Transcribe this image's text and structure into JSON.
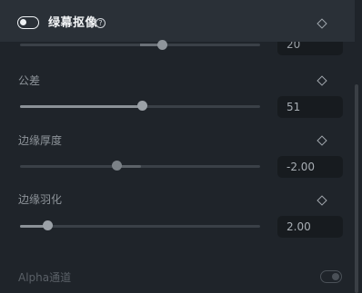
{
  "header": {
    "title": "绿幕抠像",
    "help_glyph": "?",
    "enabled": true,
    "icons": [
      "toggle-switch",
      "help-icon",
      "keyframe-diamond-icon"
    ]
  },
  "params": {
    "top_partial": {
      "value": "20",
      "slider_fraction": 0.59
    },
    "tolerance": {
      "label": "公差",
      "value": "51",
      "slider_fraction": 0.51
    },
    "edge_thickness": {
      "label": "边缘厚度",
      "value": "-2.00",
      "slider_fraction": 0.41
    },
    "edge_feather": {
      "label": "边缘羽化",
      "value": "2.00",
      "slider_fraction": 0.12
    }
  },
  "alpha": {
    "label": "Alpha通道",
    "enabled": false
  },
  "colors": {
    "background": "#1f242a",
    "header": "#2a3037",
    "value_box": "#171b1f",
    "track": "#3a4047",
    "fill": "#8b9197"
  }
}
